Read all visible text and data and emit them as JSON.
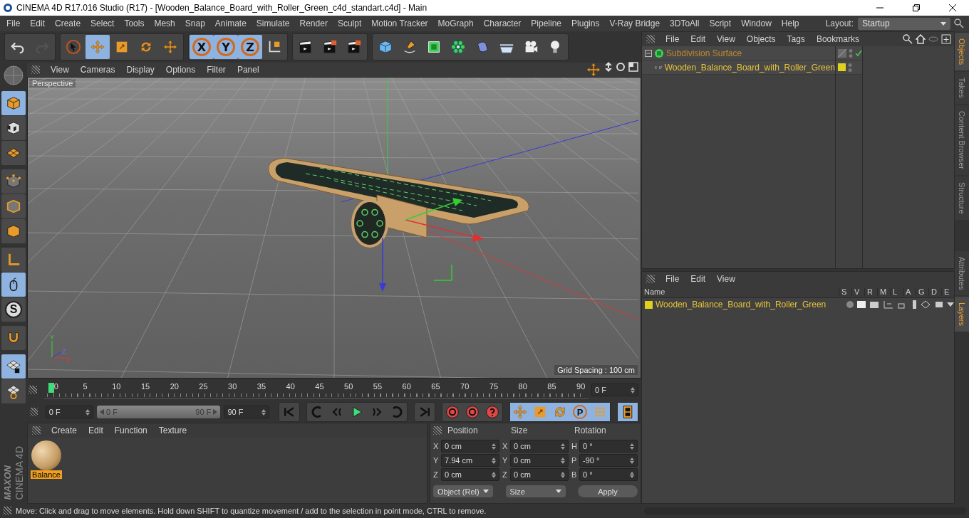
{
  "window": {
    "title": "CINEMA 4D R17.016 Studio (R17) - [Wooden_Balance_Board_with_Roller_Green_c4d_standart.c4d] - Main"
  },
  "menu": [
    "File",
    "Edit",
    "Create",
    "Select",
    "Tools",
    "Mesh",
    "Snap",
    "Animate",
    "Simulate",
    "Render",
    "Sculpt",
    "Motion Tracker",
    "MoGraph",
    "Character",
    "Pipeline",
    "Plugins",
    "V-Ray Bridge",
    "3DToAll",
    "Script",
    "Window",
    "Help"
  ],
  "layout": {
    "label": "Layout:",
    "value": "Startup"
  },
  "toolbar": [
    [
      {
        "kind": "undo",
        "disabled": false
      },
      {
        "kind": "redo",
        "disabled": true
      }
    ],
    [
      {
        "kind": "select",
        "selected": false
      },
      {
        "kind": "move",
        "selected": true
      },
      {
        "kind": "scale",
        "selected": false
      },
      {
        "kind": "rotate",
        "selected": false
      },
      {
        "kind": "move-recent",
        "selected": false
      }
    ],
    [
      {
        "kind": "axis",
        "label": "X",
        "selected": true
      },
      {
        "kind": "axis",
        "label": "Y",
        "selected": true
      },
      {
        "kind": "axis",
        "label": "Z",
        "selected": true
      },
      {
        "kind": "coords",
        "selected": false
      }
    ],
    [
      {
        "kind": "render-view"
      },
      {
        "kind": "render"
      },
      {
        "kind": "render-settings"
      }
    ],
    [
      {
        "kind": "cube"
      },
      {
        "kind": "pen"
      },
      {
        "kind": "subdivision"
      },
      {
        "kind": "cloner"
      },
      {
        "kind": "deformer"
      },
      {
        "kind": "floor"
      },
      {
        "kind": "camera"
      },
      {
        "kind": "light"
      }
    ]
  ],
  "mode_tools": [
    [
      {
        "kind": "model",
        "selected": true
      },
      {
        "kind": "texture",
        "selected": false
      },
      {
        "kind": "workplane",
        "selected": false
      }
    ],
    [
      {
        "kind": "points",
        "selected": false
      },
      {
        "kind": "edges",
        "selected": false
      },
      {
        "kind": "polygons",
        "selected": false
      }
    ],
    [
      {
        "kind": "axis",
        "selected": false
      },
      {
        "kind": "tweak",
        "selected": true
      },
      {
        "kind": "solo",
        "label": "S",
        "selected": false
      }
    ],
    [
      {
        "kind": "magnet",
        "selected": false
      }
    ],
    [
      {
        "kind": "lock-grid",
        "selected": true
      },
      {
        "kind": "rotate-grid",
        "selected": false
      }
    ]
  ],
  "logo": {
    "brand": "MAXON",
    "product": "CINEMA 4D"
  },
  "viewport": {
    "menu": [
      "View",
      "Cameras",
      "Display",
      "Options",
      "Filter",
      "Panel"
    ],
    "camera": "Perspective",
    "grid_spacing": "Grid Spacing : 100 cm",
    "axis_labels": [
      "Y",
      "Z",
      "X"
    ]
  },
  "timeline": {
    "ticks": [
      "0",
      "5",
      "10",
      "15",
      "20",
      "25",
      "30",
      "35",
      "40",
      "45",
      "50",
      "55",
      "60",
      "65",
      "70",
      "75",
      "80",
      "85",
      "90"
    ],
    "level": 0,
    "current": "0 F"
  },
  "playback": {
    "start": "0 F",
    "range": {
      "start": "0 F",
      "end": "90 F",
      "level": 1
    },
    "end": "90 F",
    "groups": [
      [
        {
          "kind": "to-start",
          "selected": false
        }
      ],
      [
        {
          "kind": "prev-key",
          "selected": false
        },
        {
          "kind": "prev-frame",
          "selected": false
        },
        {
          "kind": "play",
          "selected": false
        },
        {
          "kind": "next-frame",
          "selected": false
        },
        {
          "kind": "next-key",
          "selected": false
        }
      ],
      [
        {
          "kind": "to-end",
          "selected": false
        }
      ],
      [
        {
          "kind": "record",
          "selected": false
        },
        {
          "kind": "autokey",
          "selected": false
        },
        {
          "kind": "key-info",
          "selected": false
        }
      ],
      [
        {
          "kind": "move",
          "selected": true
        },
        {
          "kind": "scale",
          "selected": true
        },
        {
          "kind": "rotate",
          "selected": true
        },
        {
          "kind": "param",
          "label": "P",
          "selected": true
        },
        {
          "kind": "dots",
          "selected": true
        }
      ],
      [
        {
          "kind": "film",
          "selected": true
        }
      ]
    ]
  },
  "materials": {
    "menu": [
      "Create",
      "Edit",
      "Function",
      "Texture"
    ],
    "items": [
      {
        "name": "Balance",
        "selected": true
      }
    ]
  },
  "coordinates": {
    "headers": [
      "Position",
      "Size",
      "Rotation"
    ],
    "rows": [
      [
        {
          "axis": "X",
          "value": "0 cm"
        },
        {
          "axis": "X",
          "value": "0 cm"
        },
        {
          "axis": "H",
          "value": "0 °"
        }
      ],
      [
        {
          "axis": "Y",
          "value": "7.94 cm"
        },
        {
          "axis": "Y",
          "value": "0 cm"
        },
        {
          "axis": "P",
          "value": "-90 °"
        }
      ],
      [
        {
          "axis": "Z",
          "value": "0 cm"
        },
        {
          "axis": "Z",
          "value": "0 cm"
        },
        {
          "axis": "B",
          "value": "0 °"
        }
      ]
    ],
    "mode": "Object (Rel)",
    "size_mode": "Size",
    "apply": "Apply"
  },
  "status_bar": "Move: Click and drag to move elements. Hold down SHIFT to quantize movement / add to the selection in point mode, CTRL to remove.",
  "objects_panel": {
    "menu": [
      "File",
      "Edit",
      "View",
      "Objects",
      "Tags",
      "Bookmarks"
    ],
    "tree": [
      {
        "name": "Subdivision Surface",
        "expanded": true,
        "enabled": true,
        "children": [
          {
            "name": "Wooden_Balance_Board_with_Roller_Green",
            "expanded": false,
            "enabled": false,
            "color": "#e0d21c"
          }
        ]
      }
    ]
  },
  "side_tabs_top": [
    {
      "label": "Objects",
      "selected": true
    },
    {
      "label": "Takes",
      "selected": false
    },
    {
      "label": "Content Browser",
      "selected": false
    },
    {
      "label": "Structure",
      "selected": false
    }
  ],
  "layers_panel": {
    "menu": [
      "File",
      "Edit",
      "View"
    ],
    "columns": [
      "Name",
      "S",
      "V",
      "R",
      "M",
      "L",
      "A",
      "G",
      "D",
      "E"
    ],
    "rows": [
      {
        "name": "Wooden_Balance_Board_with_Roller_Green",
        "color": "#e0d21c"
      }
    ]
  },
  "side_tabs_bottom": [
    {
      "label": "Attributes",
      "selected": false
    },
    {
      "label": "Layers",
      "selected": true
    }
  ]
}
